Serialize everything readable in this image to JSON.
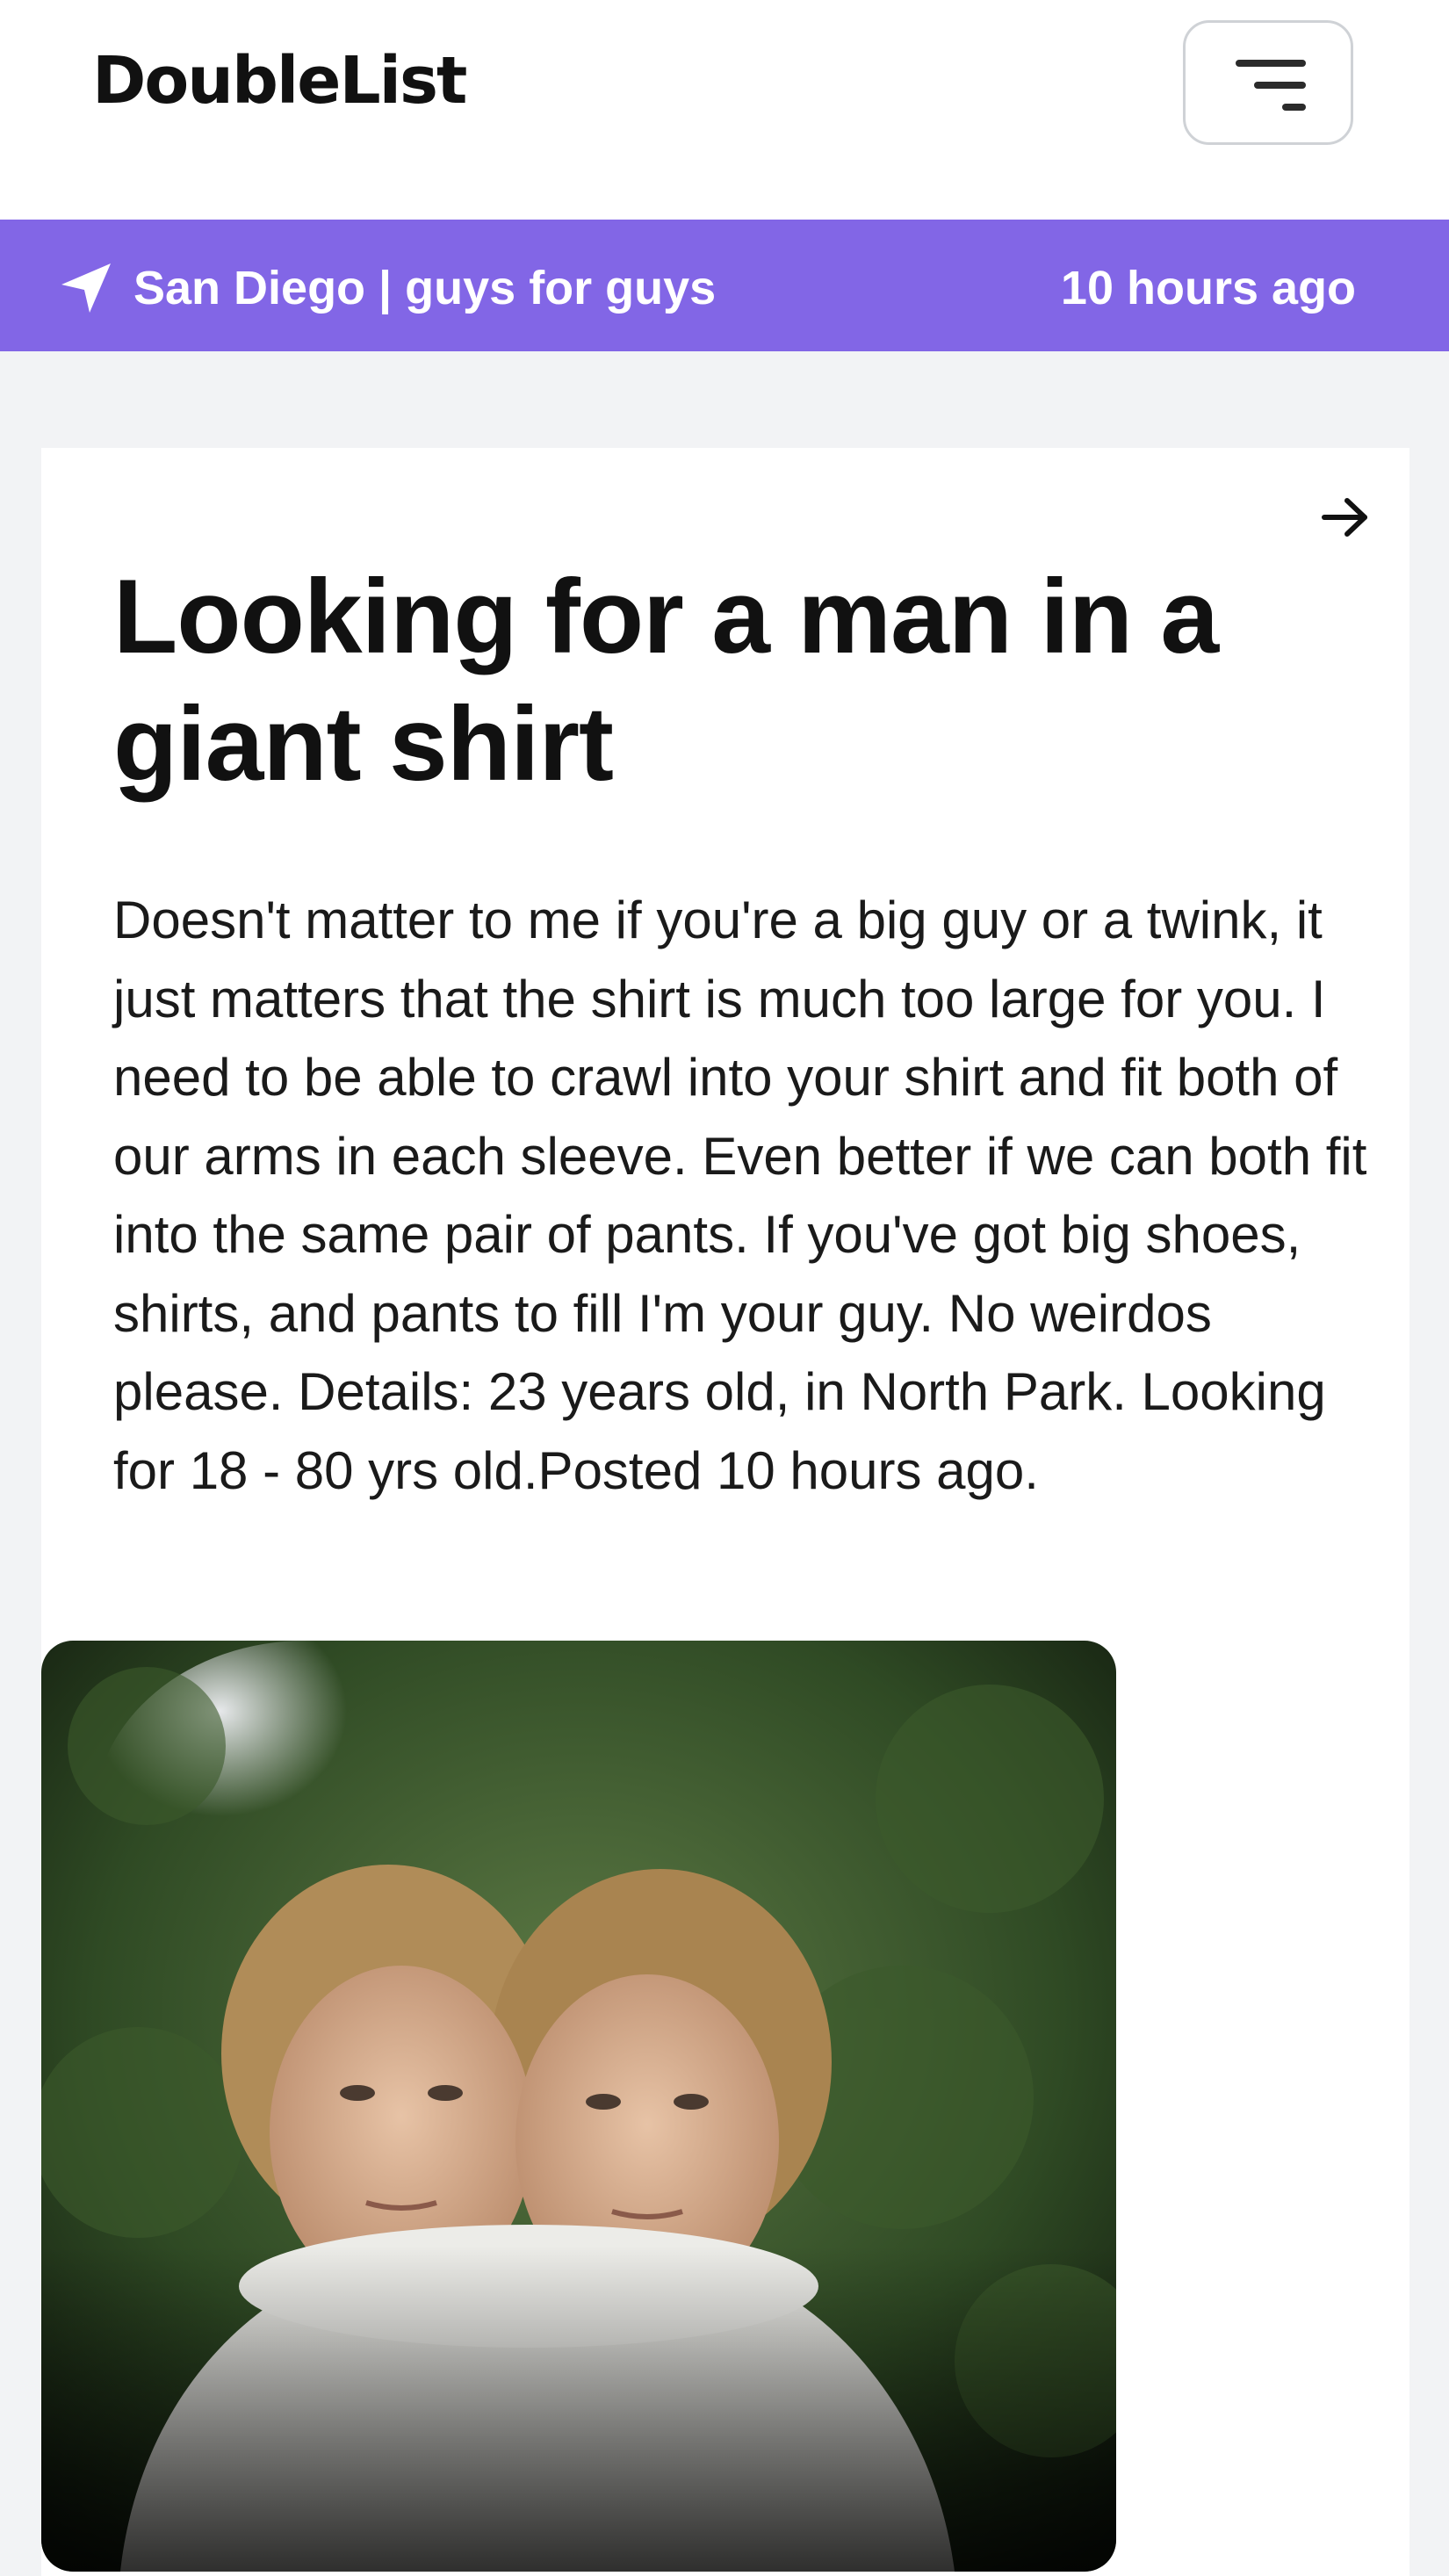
{
  "header": {
    "brand": "DoubleList",
    "menu_icon": "hamburger-menu-icon"
  },
  "location_bar": {
    "location_icon": "navigation-arrow-icon",
    "location": "San Diego | guys for guys",
    "posted_ago": "10 hours ago",
    "background_color": "#8266e6"
  },
  "post": {
    "next_icon": "arrow-right-icon",
    "title": "Looking for a man in a giant shirt",
    "body": "Doesn't matter to me if you're a big guy or a twink, it just matters that the shirt is much too large for you. I need to be able to crawl into your shirt and fit both of our arms in each sleeve. Even better if we can both fit into the same pair of pants. If you've got big shoes, shirts, and pants to fill I'm your guy. No weirdos please. Details: 23 years old, in North Park. Looking for 18 - 80 yrs old.Posted 10 hours ago."
  }
}
